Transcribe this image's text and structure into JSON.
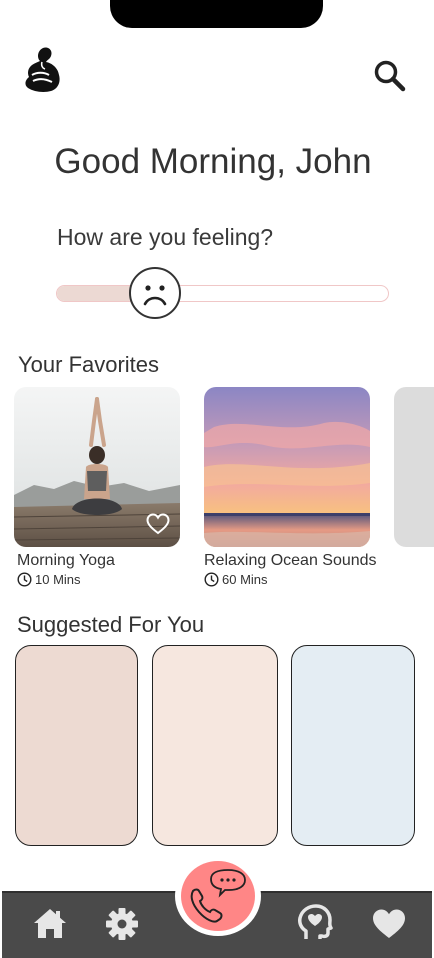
{
  "header": {
    "logo_icon": "person-embrace-logo",
    "search_icon": "search-icon"
  },
  "greeting": "Good Morning, John",
  "mood": {
    "question": "How are you feeling?",
    "level": 0.3,
    "face_icon": "sad-face-icon",
    "track_fill_color": "#ecd9d3",
    "track_border_color": "#f0c7c7"
  },
  "favorites": {
    "title": "Your Favorites",
    "items": [
      {
        "title": "Morning Yoga",
        "duration": "10 Mins",
        "image": "yoga-photo",
        "favorite_icon": "heart-outline-icon"
      },
      {
        "title": "Relaxing Ocean Sounds",
        "duration": "60 Mins",
        "image": "ocean-sunset-photo"
      }
    ]
  },
  "suggested": {
    "title": "Suggested For You",
    "cards": [
      {
        "color": "#eddad2"
      },
      {
        "color": "#f6e7df"
      },
      {
        "color": "#e4edf3"
      }
    ]
  },
  "nav": {
    "bar_color": "#4a4a4a",
    "items": [
      {
        "icon": "home-icon"
      },
      {
        "icon": "gear-icon"
      },
      {
        "icon": "chat-call-icon",
        "color": "#ff8686"
      },
      {
        "icon": "head-heart-icon"
      },
      {
        "icon": "heart-icon"
      }
    ]
  }
}
